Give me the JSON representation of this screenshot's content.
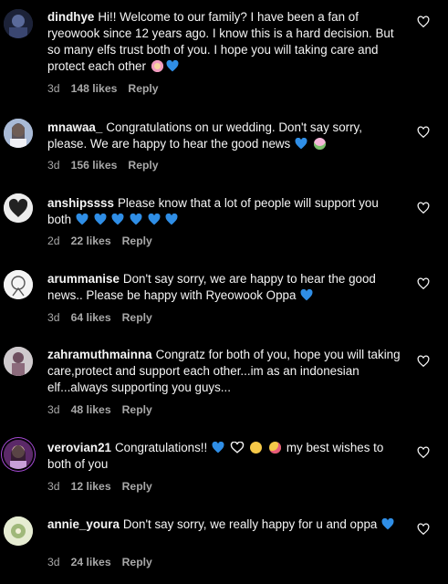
{
  "comments": [
    {
      "username": "dindhye",
      "text": "Hi!! Welcome to our family? I have been a fan of ryeowook since 12 years ago. I know this is a hard decision. But so many elfs trust both of you. I hope you will taking care and protect each other",
      "emojis": [
        "flower-emoji",
        "blue-heart"
      ],
      "age": "3d",
      "likes": "148 likes",
      "reply": "Reply",
      "avatar_color": "#2a3352"
    },
    {
      "username": "mnawaa_",
      "text": "Congratulations on ur wedding. Don't say sorry, please. We are happy to hear the good news",
      "emojis": [
        "blue-heart",
        "bouquet-emoji"
      ],
      "age": "3d",
      "likes": "156 likes",
      "reply": "Reply",
      "avatar_color": "#b7c4da"
    },
    {
      "username": "anshipssss",
      "text": "Please know that a lot of people will support you both",
      "emojis": [
        "blue-heart",
        "blue-heart",
        "blue-heart",
        "blue-heart",
        "blue-heart",
        "blue-heart"
      ],
      "age": "2d",
      "likes": "22 likes",
      "reply": "Reply",
      "avatar_color": "#e9e9e9"
    },
    {
      "username": "arummanise",
      "text": "Don't say sorry, we are happy to hear the good news.. Please be happy with Ryeowook Oppa",
      "emojis": [
        "blue-heart"
      ],
      "age": "3d",
      "likes": "64 likes",
      "reply": "Reply",
      "avatar_color": "#f2f2f2"
    },
    {
      "username": "zahramuthmainna",
      "text": "Congratz for both of you, hope you will taking care,protect and support each other...im as an indonesian elf...always supporting you guys...",
      "emojis": [],
      "age": "3d",
      "likes": "48 likes",
      "reply": "Reply",
      "avatar_color": "#c9c6c8"
    },
    {
      "username": "verovian21",
      "text": "Congratulations!!",
      "emojis": [
        "blue-heart",
        "heart-hands-emoji",
        "clap-emoji",
        "kiss-emoji"
      ],
      "text_after": "my best wishes to both of you",
      "age": "3d",
      "likes": "12 likes",
      "reply": "Reply",
      "avatar_color": "#6b2f7a"
    },
    {
      "username": "annie_youra",
      "text": "Don't say sorry, we really happy for u and oppa",
      "emojis": [
        "blue-heart"
      ],
      "age": "3d",
      "likes": "24 likes",
      "reply": "Reply",
      "avatar_color": "#dfe7c8"
    }
  ],
  "colors": {
    "blue_heart": "#2f8ee6",
    "meta": "#a8a8a8",
    "text": "#f5f5f5"
  }
}
